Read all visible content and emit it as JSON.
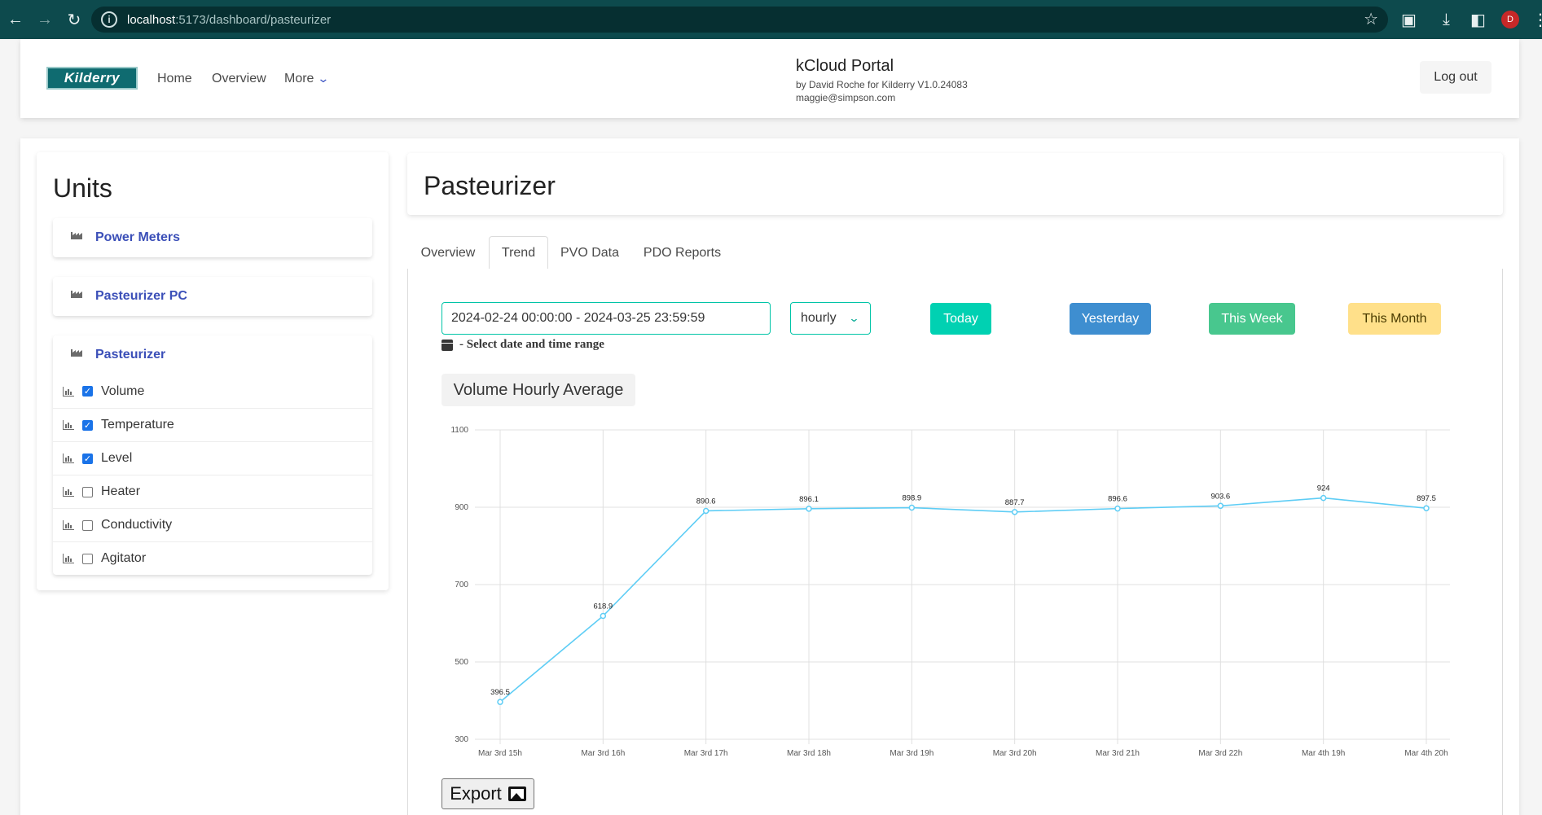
{
  "browser": {
    "url_host": "localhost",
    "url_rest": ":5173/dashboard/pasteurizer",
    "profile_initial": "D"
  },
  "header": {
    "logo_text": "Kilderry",
    "nav": {
      "home": "Home",
      "overview": "Overview",
      "more": "More"
    },
    "portal_title": "kCloud Portal",
    "portal_byline": "by David Roche for Kilderry V1.0.24083",
    "user_email": "maggie@simpson.com",
    "logout_label": "Log out"
  },
  "sidebar": {
    "title": "Units",
    "units": [
      {
        "label": "Power Meters"
      },
      {
        "label": "Pasteurizer PC"
      },
      {
        "label": "Pasteurizer"
      }
    ],
    "sensors": [
      {
        "label": "Volume",
        "checked": true
      },
      {
        "label": "Temperature",
        "checked": true
      },
      {
        "label": "Level",
        "checked": true
      },
      {
        "label": "Heater",
        "checked": false
      },
      {
        "label": "Conductivity",
        "checked": false
      },
      {
        "label": "Agitator",
        "checked": false
      }
    ]
  },
  "main": {
    "title": "Pasteurizer",
    "tabs": [
      "Overview",
      "Trend",
      "PVO Data",
      "PDO Reports"
    ],
    "active_tab": "Trend",
    "date_range_value": "2024-02-24 00:00:00 - 2024-03-25 23:59:59",
    "date_range_hint": "- Select date and time range",
    "interval_value": "hourly",
    "buttons": {
      "today": "Today",
      "yesterday": "Yesterday",
      "this_week": "This Week",
      "this_month": "This Month"
    },
    "button_colors": {
      "today": "#00d1b2",
      "yesterday": "#3e8ed0",
      "this_week": "#48c78e",
      "this_month": "#ffe08a"
    },
    "export_label": "Export"
  },
  "chart_data": {
    "type": "line",
    "title": "Volume Hourly Average",
    "categories": [
      "Mar 3rd 15h",
      "Mar 3rd 16h",
      "Mar 3rd 17h",
      "Mar 3rd 18h",
      "Mar 3rd 19h",
      "Mar 3rd 20h",
      "Mar 3rd 21h",
      "Mar 3rd 22h",
      "Mar 4th 19h",
      "Mar 4th 20h"
    ],
    "values": [
      396.5,
      618.9,
      890.6,
      896.1,
      898.9,
      887.7,
      896.6,
      903.6,
      924,
      897.5
    ],
    "data_labels": [
      "396.5",
      "618.9",
      "890.6",
      "896.1",
      "898.9",
      "887.7",
      "896.6",
      "903.6",
      "924",
      "897.5"
    ],
    "ylim": [
      300,
      1100
    ],
    "yticks": [
      "1100",
      "900",
      "700",
      "500",
      "300"
    ],
    "ytick_values": [
      1100,
      900,
      700,
      500,
      300
    ],
    "grid": true,
    "line_color": "#5ecdf5"
  }
}
